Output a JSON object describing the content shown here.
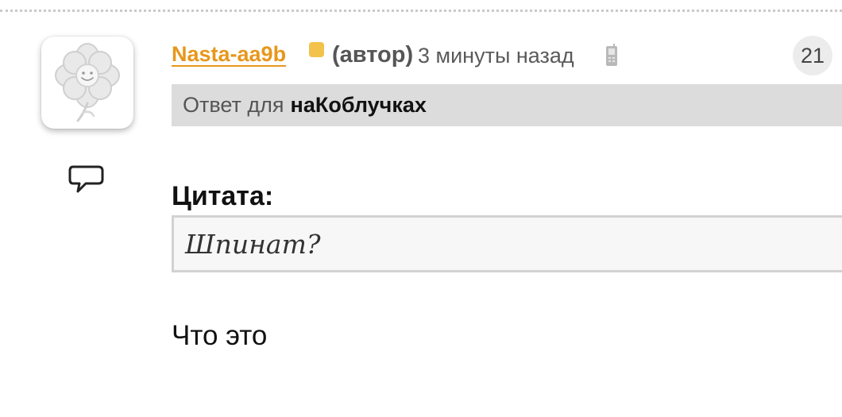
{
  "post": {
    "username": "Nasta-aa9b",
    "author_tag": "(автор)",
    "timestamp": "3 минуты назад",
    "count": "21",
    "reply": {
      "prefix": "Ответ для",
      "target": "наКоблучках"
    },
    "quote": {
      "title": "Цитата:",
      "text": "Шпинат?"
    },
    "body": "Что это"
  },
  "icons": {
    "avatar": "flower-avatar-icon",
    "comment": "speech-bubble-icon",
    "device": "mobile-phone-icon",
    "status": "status-dot-icon"
  },
  "colors": {
    "username": "#e7971c",
    "status_dot": "#f2c24a",
    "reply_bar": "#dcdcdc",
    "quote_border": "#d2d2d2"
  }
}
